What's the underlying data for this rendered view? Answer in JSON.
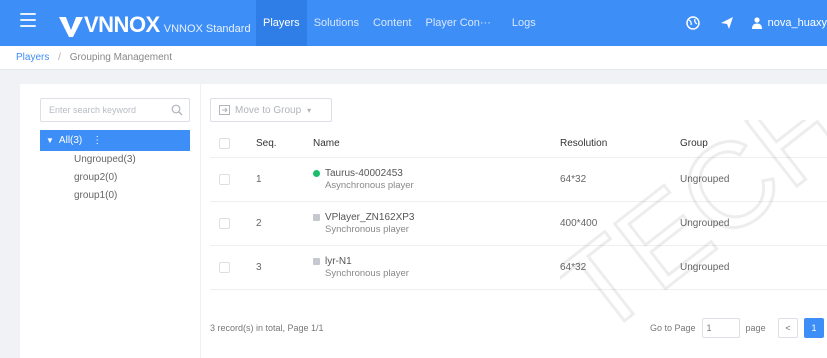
{
  "colors": {
    "primary": "#3e8ef7",
    "online": "#19be6b",
    "offline": "#c5c8ce"
  },
  "header": {
    "brand": "VNNOX",
    "edition": "VNNOX Standard",
    "nav": [
      {
        "label": "Players",
        "active": true
      },
      {
        "label": "Solutions",
        "active": false
      },
      {
        "label": "Content",
        "active": false
      },
      {
        "label": "Player Con···",
        "active": false
      },
      {
        "label": "Logs",
        "active": false
      }
    ],
    "icons": [
      "globe-icon",
      "send-icon",
      "user-icon"
    ],
    "user": "nova_huaxy"
  },
  "breadcrumb": {
    "parent": "Players",
    "separator": "/",
    "current": "Grouping Management"
  },
  "sidebar": {
    "search_placeholder": "Enter search keyword",
    "tree": {
      "root": {
        "label": "All(3)",
        "more": "⋮"
      },
      "children": [
        "Ungrouped(3)",
        "group2(0)",
        "group1(0)"
      ]
    }
  },
  "toolbar": {
    "move_to_group": "Move to Group"
  },
  "table": {
    "columns": {
      "seq": "Seq.",
      "name": "Name",
      "resolution": "Resolution",
      "group": "Group"
    },
    "rows": [
      {
        "seq": "1",
        "name": "Taurus-40002453",
        "type": "Asynchronous player",
        "status": "online",
        "resolution": "64*32",
        "group": "Ungrouped"
      },
      {
        "seq": "2",
        "name": "VPlayer_ZN162XP3",
        "type": "Synchronous player",
        "status": "offline",
        "resolution": "400*400",
        "group": "Ungrouped"
      },
      {
        "seq": "3",
        "name": "lyr-N1",
        "type": "Synchronous player",
        "status": "offline",
        "resolution": "64*32",
        "group": "Ungrouped"
      }
    ]
  },
  "pagination": {
    "total_text": "3 record(s) in total, Page 1/1",
    "goto_label": "Go to Page",
    "goto_value": "1",
    "page_label": "page",
    "prev": "<",
    "current_page": "1",
    "next": ">"
  },
  "watermark": "TECH"
}
